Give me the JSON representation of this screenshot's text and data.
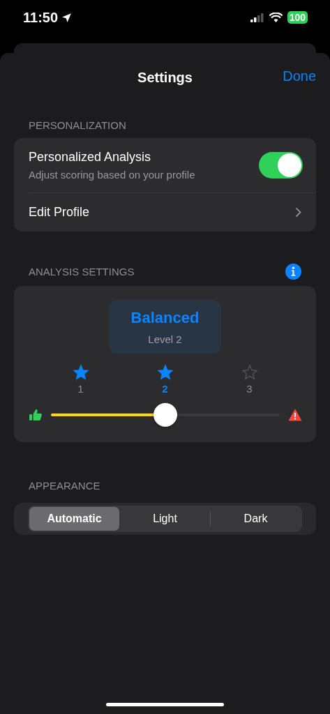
{
  "status_bar": {
    "time": "11:50",
    "battery": "100"
  },
  "nav": {
    "title": "Settings",
    "done": "Done"
  },
  "personalization": {
    "header": "PERSONALIZATION",
    "toggle": {
      "title": "Personalized Analysis",
      "subtitle": "Adjust scoring based on your profile",
      "on": true
    },
    "edit_profile": "Edit Profile"
  },
  "analysis": {
    "header": "ANALYSIS SETTINGS",
    "mode": "Balanced",
    "level_text": "Level 2",
    "options": [
      {
        "label": "1",
        "filled": true,
        "selected": false
      },
      {
        "label": "2",
        "filled": true,
        "selected": true
      },
      {
        "label": "3",
        "filled": false,
        "selected": false
      }
    ],
    "slider": {
      "level": 0.5
    }
  },
  "appearance": {
    "header": "APPEARANCE",
    "segments": [
      {
        "label": "Automatic",
        "selected": true
      },
      {
        "label": "Light",
        "selected": false
      },
      {
        "label": "Dark",
        "selected": false
      }
    ]
  }
}
